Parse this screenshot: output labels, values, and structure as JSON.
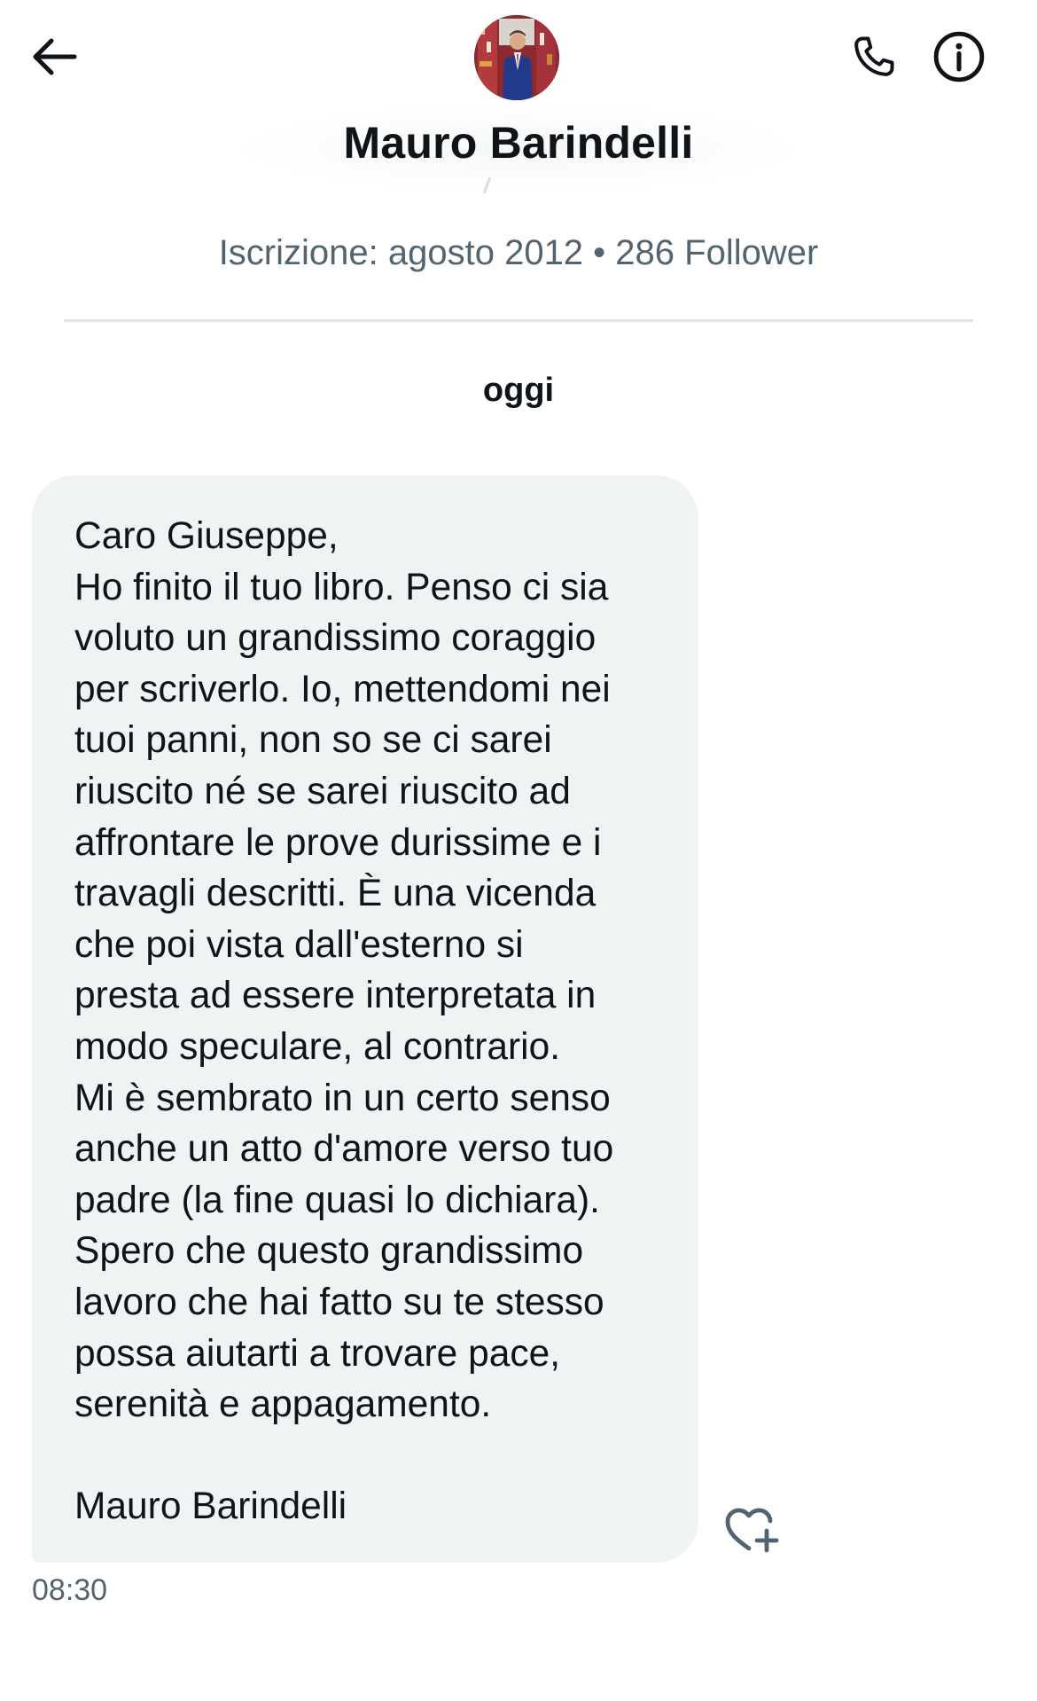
{
  "header": {
    "back_icon": "arrow-left-icon",
    "avatar": "profile-photo",
    "call_icon": "phone-icon",
    "info_icon": "info-circle-icon",
    "display_name": "Mauro Barindelli",
    "profile_meta": "Iscrizione: agosto 2012 • 286 Follower"
  },
  "conversation": {
    "date_separator": "oggi",
    "messages": [
      {
        "text": "Caro Giuseppe,\nHo finito il tuo libro. Penso ci sia\nvoluto un grandissimo coraggio\nper scriverlo. Io, mettendomi nei\ntuoi panni, non so se ci sarei\nriuscito né se sarei riuscito ad\naffrontare le prove durissime e i\ntravagli descritti. È una vicenda\nche poi vista dall'esterno si\npresta ad essere interpretata in\nmodo speculare, al contrario.\nMi è sembrato in un certo senso\nanche un atto d'amore verso tuo\npadre (la fine quasi lo dichiara).\nSpero che questo grandissimo\nlavoro che hai fatto su te stesso\npossa aiutarti a trovare pace,\nserenità e appagamento.\n\nMauro Barindelli",
        "time": "08:30",
        "reaction_icon": "heart-plus-icon"
      }
    ]
  },
  "colors": {
    "text_primary": "#0f1419",
    "text_secondary": "#536471",
    "bubble_background": "#eff3f4",
    "divider": "#e1e4e6"
  }
}
